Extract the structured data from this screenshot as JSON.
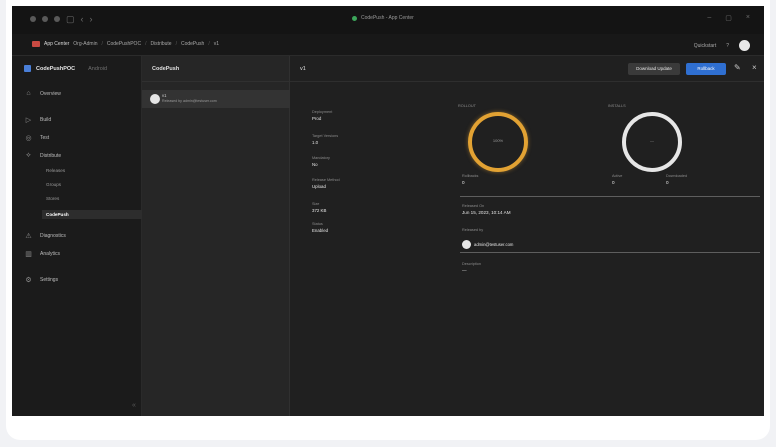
{
  "titlebar": {
    "window_title": "CodePush - App Center",
    "nav_back_icon": "back-arrow-icon",
    "nav_forward_icon": "forward-arrow-icon"
  },
  "breadcrumb": {
    "app_name": "App Center",
    "items": [
      "Org-Admin",
      "CodePushPOC",
      "Distribute",
      "CodePush",
      "v1"
    ],
    "right_link": "Quickstart",
    "help_label": "?"
  },
  "sidebar": {
    "app_title": "CodePushPOC",
    "app_sub": "Android",
    "items": [
      {
        "icon": "home-icon",
        "glyph": "⌂",
        "label": "Overview"
      },
      {
        "icon": "build-icon",
        "glyph": "▷",
        "label": "Build"
      },
      {
        "icon": "test-icon",
        "glyph": "◎",
        "label": "Test"
      },
      {
        "icon": "distribute-icon",
        "glyph": "⟡",
        "label": "Distribute"
      }
    ],
    "sub_items": [
      "Releases",
      "Groups",
      "Stores",
      "CodePush"
    ],
    "active_sub": "CodePush",
    "bottom_items": [
      {
        "icon": "diagnostics-icon",
        "glyph": "⚠",
        "label": "Diagnostics"
      },
      {
        "icon": "analytics-icon",
        "glyph": "▥",
        "label": "Analytics"
      },
      {
        "icon": "settings-icon",
        "glyph": "⚙",
        "label": "Settings"
      }
    ],
    "collapse_glyph": "«"
  },
  "list": {
    "title": "CodePush",
    "selected_name": "v1",
    "selected_desc": "Released by admin@testuser.com"
  },
  "main": {
    "title": "v1",
    "download_label": "Download Update",
    "primary_label": "Rollback",
    "properties": [
      {
        "label": "Deployment",
        "value": "Prod"
      },
      {
        "label": "Target Versions",
        "value": "1.0"
      },
      {
        "label": "Mandatory",
        "value": "No"
      },
      {
        "label": "Release Method",
        "value": "Upload"
      },
      {
        "label": "Size",
        "value": "372 KB"
      },
      {
        "label": "Status",
        "value": "Enabled"
      }
    ],
    "rollout_label": "ROLLOUT",
    "rollout_value": "100%",
    "installs_label": "INSTALLS",
    "installs_value": "—",
    "rollbacks_label": "Rollbacks",
    "rollbacks_value": "0",
    "active_label": "Active",
    "active_value": "0",
    "downloaded_label": "Downloaded",
    "downloaded_value": "0",
    "released_on_label": "Released On",
    "released_on_value": "Jun 15, 2023, 10:14 AM",
    "released_by_label": "Released by",
    "released_by_value": "admin@testuser.com",
    "description_label": "Description",
    "description_value": "—"
  },
  "colors": {
    "rollout_ring": "#e2a233",
    "installs_ring": "#e6e6e6",
    "primary_button": "#2f6fd1"
  }
}
